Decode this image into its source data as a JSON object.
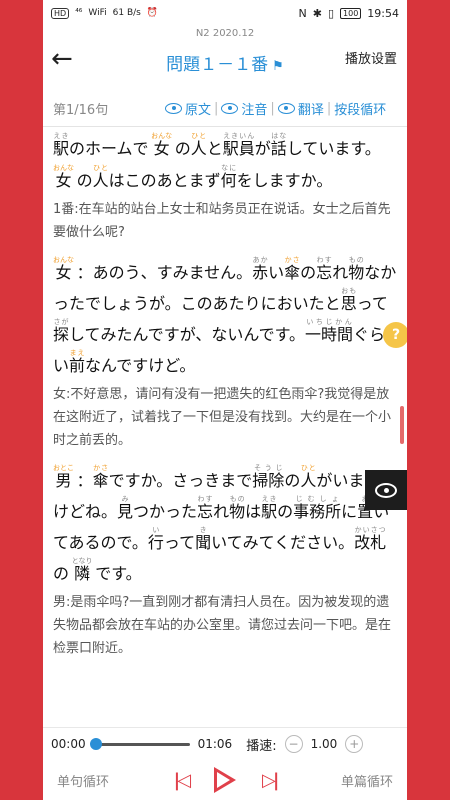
{
  "status": {
    "left": [
      "HD",
      "⁴⁶",
      "WiFi",
      "61 B/s",
      "⏰"
    ],
    "right": [
      "N",
      "✱",
      "▯",
      "100",
      "19:54"
    ]
  },
  "header": {
    "subtitle": "N2 2020.12",
    "title": "問題１－１番",
    "settings": "播放设置"
  },
  "toolbar": {
    "counter": "第1/16句",
    "original": "原文",
    "annotation": "注音",
    "translation": "翻译",
    "loop": "按段循环"
  },
  "lines": {
    "b1_zh": "1番:在车站的站台上女士和站务员正在说话。女士之后首先要做什么呢?",
    "b2_zh": "女:不好意思，请问有没有一把遗失的红色雨伞?我觉得是放在这附近了，试着找了一下但是没有找到。大约是在一个小时之前丢的。",
    "b3_zh": "男:是雨伞吗?一直到刚才都有清扫人员在。因为被发现的遗失物品都会放在车站的办公室里。请您过去问一下吧。是在检票口附近。"
  },
  "player": {
    "current": "00:00",
    "total": "01:06",
    "speed_label": "播速:",
    "speed": "1.00",
    "progress": 0,
    "single_loop": "单句循环",
    "full_loop": "单篇循环"
  },
  "colors": {
    "accent": "#2a8fd6",
    "play": "#e0404a",
    "ruby_name": "#f0a030",
    "frame": "#d8353c"
  },
  "icons": [
    "back-arrow-icon",
    "flag-icon",
    "eye-icon",
    "question-icon",
    "minus-icon",
    "plus-icon",
    "prev-icon",
    "play-icon",
    "next-icon"
  ]
}
